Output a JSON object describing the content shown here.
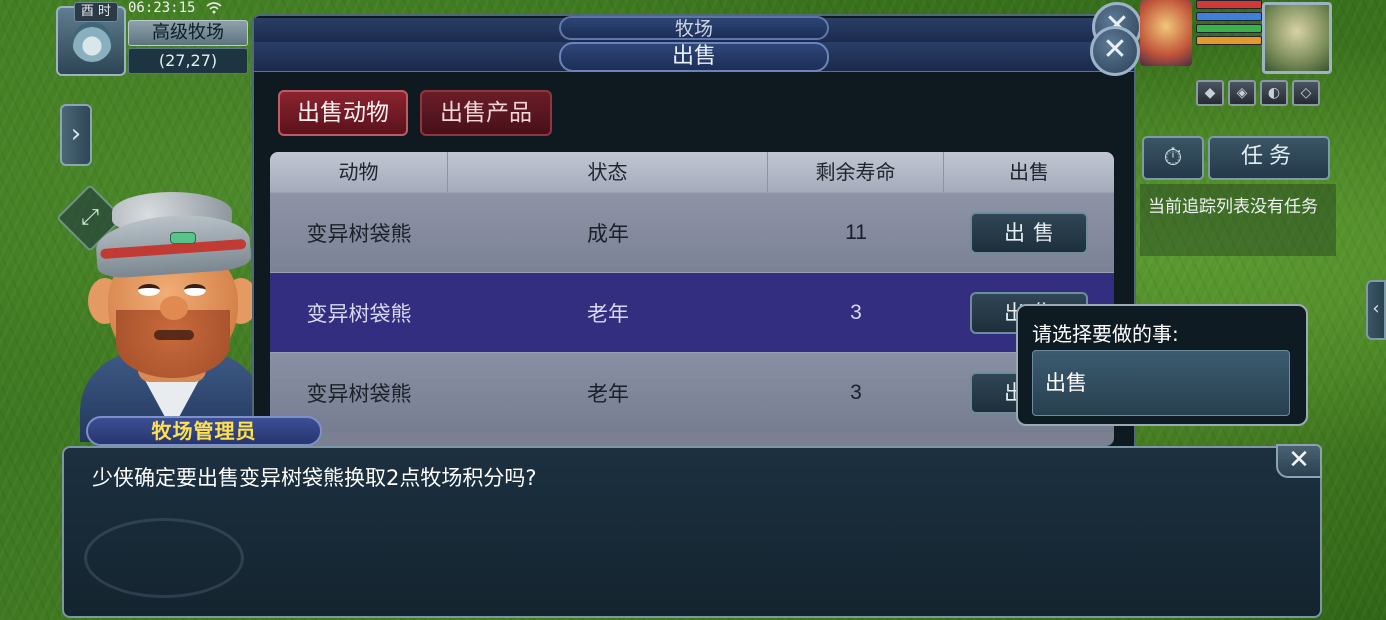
{
  "hud": {
    "time_period": "酉 时",
    "clock": "06:23:15",
    "location_name": "高级牧场",
    "coordinates": "(27,27)"
  },
  "window": {
    "back_title": "牧场",
    "title": "出售",
    "close_icon": "✕"
  },
  "tabs": [
    {
      "label": "出售动物",
      "active": true
    },
    {
      "label": "出售产品",
      "active": false
    }
  ],
  "table": {
    "headers": [
      "动物",
      "状态",
      "剩余寿命",
      "出售"
    ],
    "rows": [
      {
        "animal": "变异树袋熊",
        "status": "成年",
        "lifespan": "11",
        "action": "出售"
      },
      {
        "animal": "变异树袋熊",
        "status": "老年",
        "lifespan": "3",
        "action": "出售",
        "selected": true
      },
      {
        "animal": "变异树袋熊",
        "status": "老年",
        "lifespan": "3",
        "action": "出售"
      }
    ]
  },
  "npc": {
    "name": "牧场管理员"
  },
  "dialog": {
    "text": "少侠确定要出售变异树袋熊换取2点牧场积分吗?",
    "close_icon": "✕"
  },
  "choice": {
    "prompt": "请选择要做的事:",
    "option": "出售"
  },
  "side": {
    "task_label": "任务",
    "task_empty": "当前追踪列表没有任务",
    "timer_icon": "⏱",
    "left_tab_icon": "›",
    "right_tab_icon": "‹",
    "expand_icon": "⤢"
  },
  "colors": {
    "selected_row": "#332e80",
    "active_tab": "#8a2430",
    "npc_name": "#ffe14a"
  }
}
